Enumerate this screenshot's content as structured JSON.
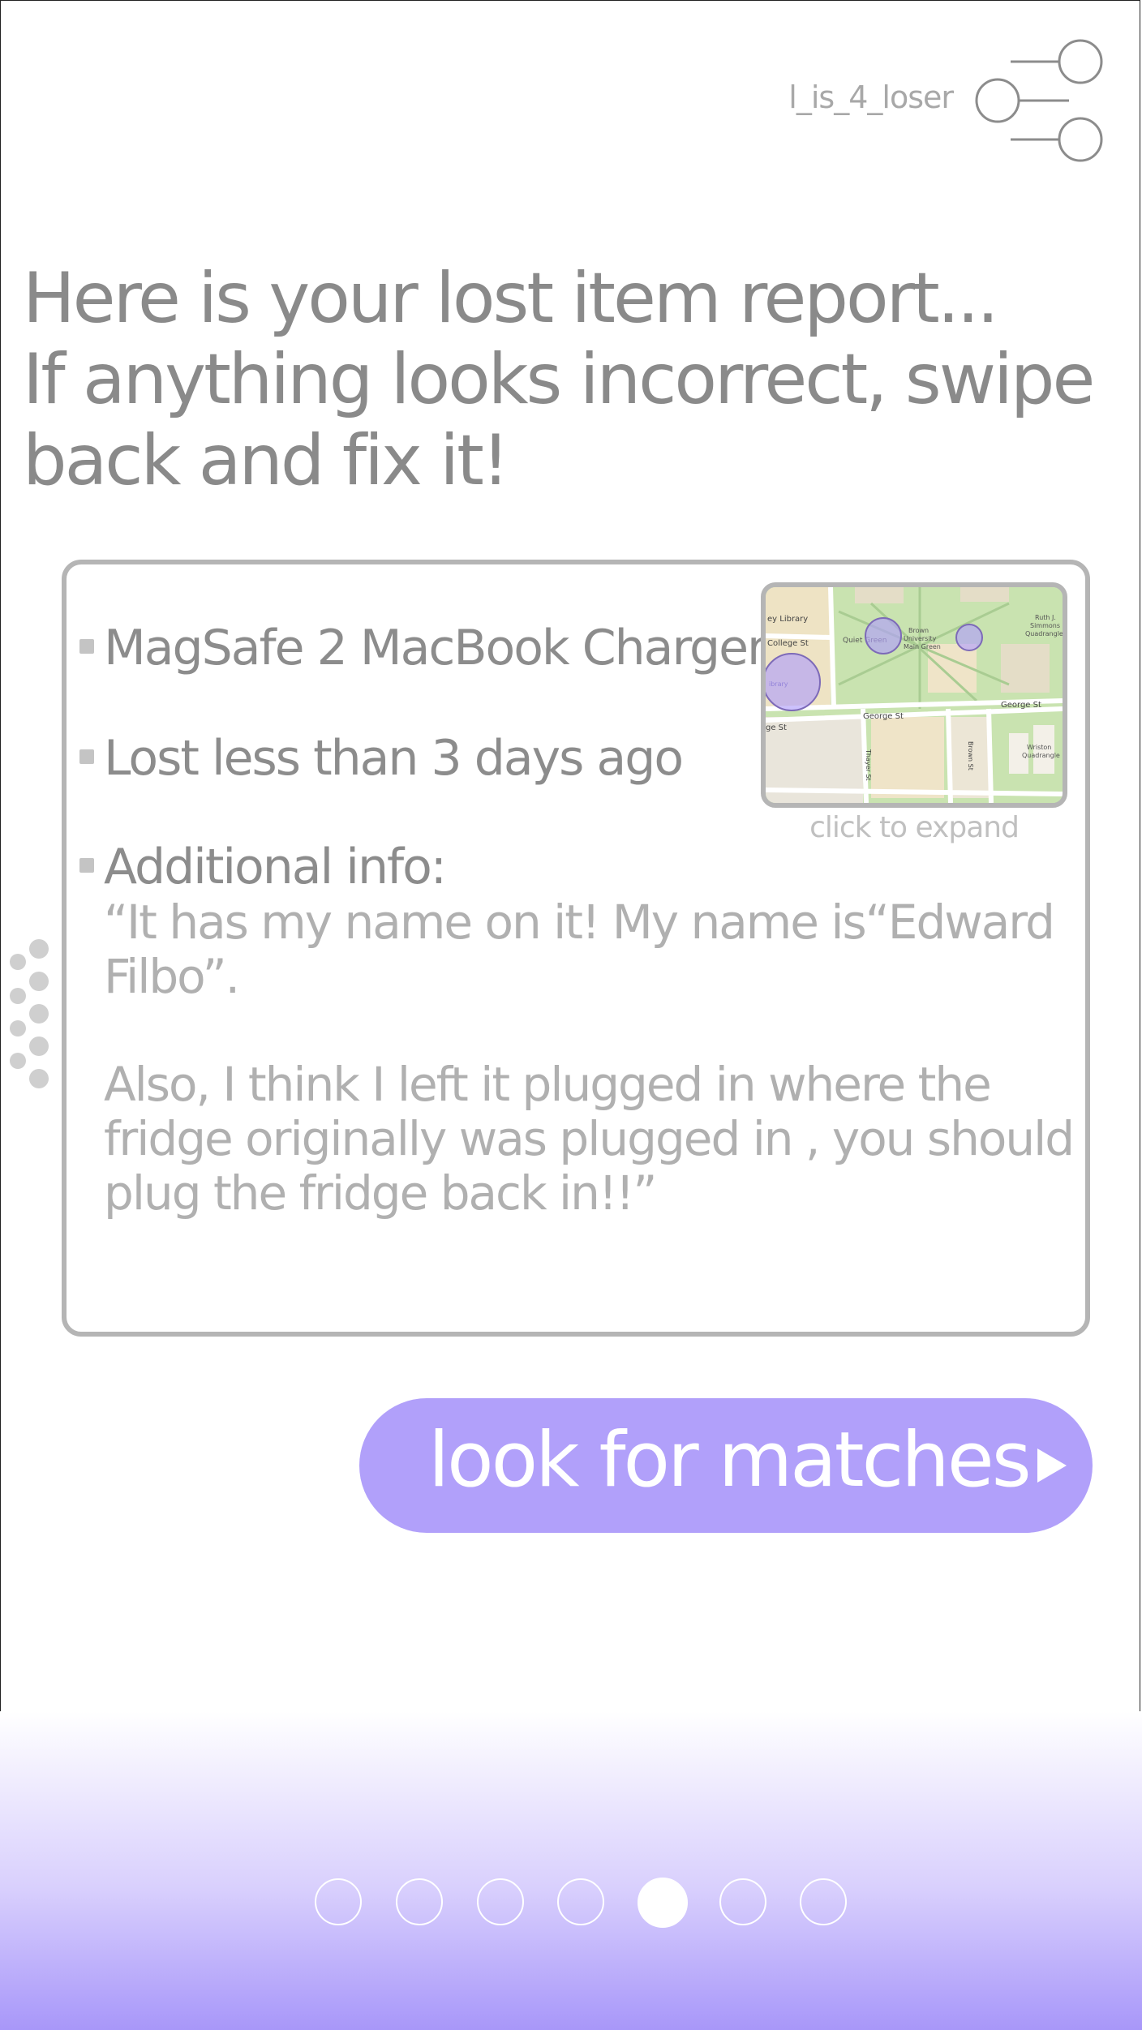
{
  "header": {
    "username": "l_is_4_loser",
    "menu_icon": "settings-sliders-icon"
  },
  "headline": {
    "line1": "Here is your lost item report...",
    "line2": "If anything looks incorrect, swipe",
    "line3": "back and fix it!"
  },
  "report": {
    "item_name": "MagSafe 2 MacBook Charger",
    "time_lost": "Lost less than 3 days ago",
    "additional_label": "Additional info:",
    "note_lines": [
      "“It has my name on it! My name is“Edward",
      "Filbo”.",
      "Also, I think I left it plugged in where the",
      "fridge originally was plugged in , you should",
      "plug the fridge back in!!”"
    ],
    "map_labels": {
      "library": "ey Library",
      "college": "College St",
      "quiet_green": "Quiet Green",
      "brown_green_1": "Brown",
      "brown_green_2": "University",
      "brown_green_3": "Main Green",
      "ruth_1": "Ruth J.",
      "ruth_2": "Simmons",
      "ruth_3": "Quadrangle",
      "george_1": "George St",
      "george_2": "George St",
      "george_3": "ge St",
      "library_short": "ibrary",
      "thayer": "Thayer St",
      "brown_st": "Brown St",
      "wriston_1": "Wriston",
      "wriston_2": "Quadrangle"
    },
    "expand_label": "click to expand"
  },
  "cta": {
    "label": "look for matches"
  },
  "pager": {
    "count": 7,
    "active_index": 4
  },
  "colors": {
    "accent": "#b1a0fa",
    "text_primary": "#8a8a8a",
    "text_secondary": "#b0b0b0",
    "border": "#b5b5b5"
  }
}
